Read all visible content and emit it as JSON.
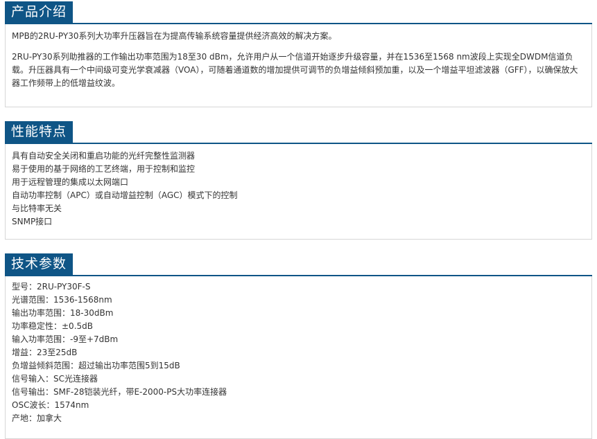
{
  "intro": {
    "title": "产品介绍",
    "para1": "MPB的2RU-PY30系列大功率升压器旨在为提高传输系统容量提供经济高效的解决方案。",
    "para2": "2RU-PY30系列助推器的工作输出功率范围为18至30 dBm，允许用户从一个信道开始逐步升级容量，并在1536至1568 nm波段上实现全DWDM信道负载。升压器具有一个中间级可变光学衰减器（VOA），可随着通道数的增加提供可调节的负增益倾斜预加重，以及一个增益平坦滤波器（GFF），以确保放大器工作频带上的低增益纹波。"
  },
  "features": {
    "title": "性能特点",
    "items": [
      "具有自动安全关闭和重启功能的光纤完整性监测器",
      "易于使用的基于网络的工艺终端，用于控制和监控",
      "用于远程管理的集成以太网端口",
      "自动功率控制（APC）或自动增益控制（AGC）模式下的控制",
      "与比特率无关",
      "SNMP接口"
    ]
  },
  "specs": {
    "title": "技术参数",
    "items": [
      "型号：2RU-PY30F-S",
      "光谱范围：1536-1568nm",
      "输出功率范围：18-30dBm",
      "功率稳定性：±0.5dB",
      "输入功率范围：-9至+7dBm",
      "增益：23至25dB",
      "负增益倾斜范围：超过输出功率范围5到15dB",
      "信号输入：SC光连接器",
      "信号输出：SMF-28铠装光纤，带E-2000-PS大功率连接器",
      "OSC波长：1574nm",
      "产地：加拿大"
    ]
  }
}
